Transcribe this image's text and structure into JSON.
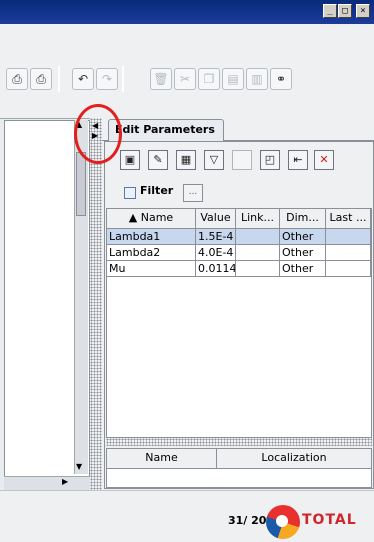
{
  "window": {
    "buttons": [
      "_",
      "□",
      "×"
    ]
  },
  "toolbar": {
    "icons": [
      "print-preview-icon",
      "print-icon",
      "undo-icon",
      "redo-icon",
      "delete-icon",
      "cut-icon",
      "copy-icon",
      "paste-icon",
      "paste-special-icon",
      "link-icon"
    ]
  },
  "edit_parameters": {
    "tab_label": "Edit Parameters",
    "filter_label": "Filter",
    "filter_more": "...",
    "columns": [
      "Name",
      "Value",
      "Link...",
      "Dim...",
      "Last ..."
    ],
    "sort_indicator": "▲",
    "rows": [
      {
        "name": "Lambda1",
        "value": "1.5E-4",
        "link": "",
        "dim": "Other",
        "last": "",
        "selected": true
      },
      {
        "name": "Lambda2",
        "value": "4.0E-4",
        "link": "",
        "dim": "Other",
        "last": "",
        "selected": false
      },
      {
        "name": "Mu",
        "value": "0.0114",
        "link": "",
        "dim": "Other",
        "last": "",
        "selected": false
      }
    ]
  },
  "localization_table": {
    "columns": [
      "Name",
      "Localization"
    ]
  },
  "status": {
    "page_count": "31/ 201",
    "brand": "TOTAL"
  },
  "colors": {
    "title_bar": "#0a2a7a",
    "annotation": "#e41d1d",
    "selection": "#c7d7ee"
  }
}
